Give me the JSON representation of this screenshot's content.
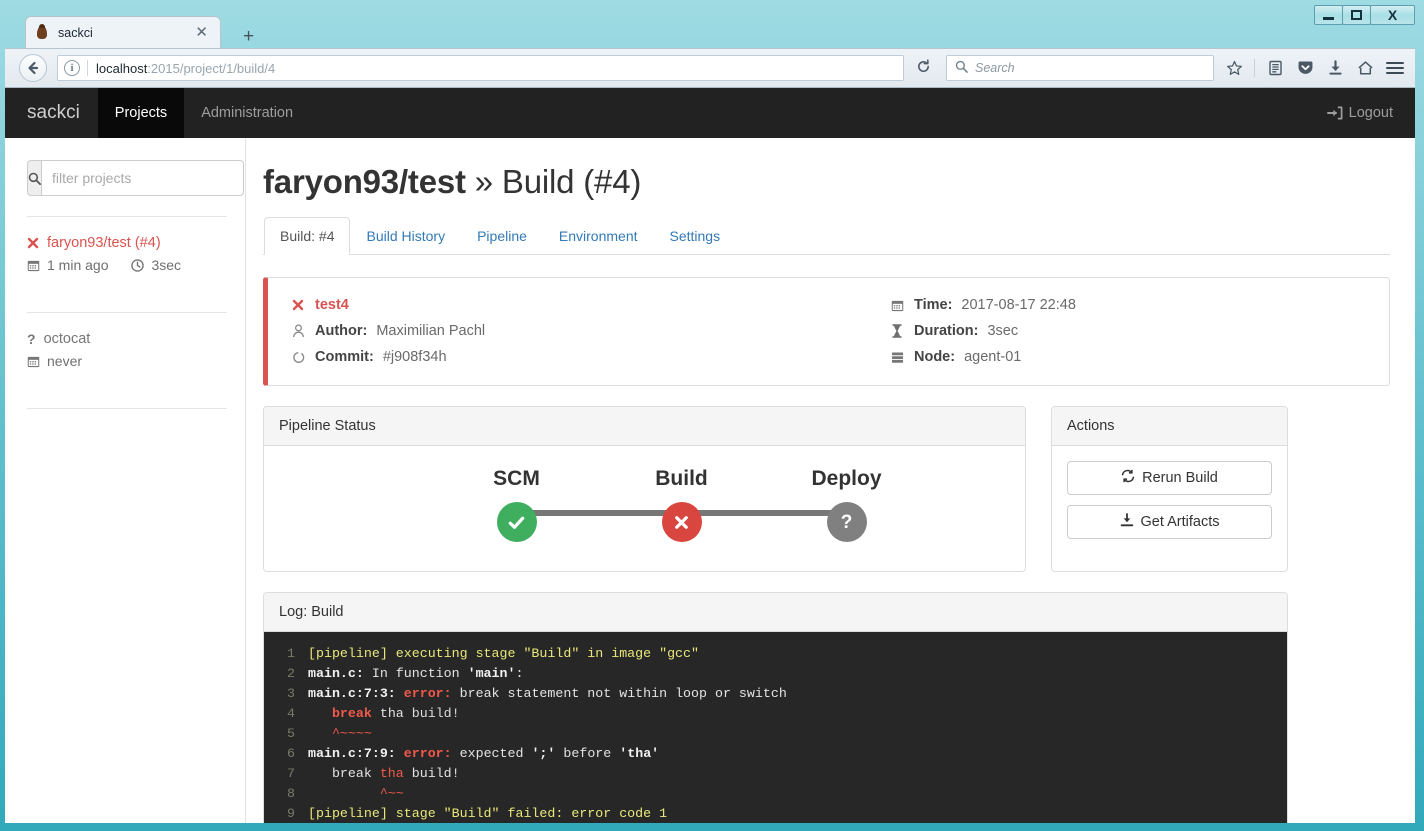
{
  "window": {
    "minimize_label": "Minimize",
    "maximize_label": "Maximize",
    "close_label": "Close"
  },
  "browser": {
    "tab_title": "sackci",
    "tab_close_glyph": "✕",
    "newtab_glyph": "+",
    "back_glyph": "←",
    "reload_glyph": "⟳",
    "url_host": "localhost",
    "url_rest": ":2015/project/1/build/4",
    "search_placeholder": "Search",
    "search_glyph": "⚲",
    "identity_glyph": "i",
    "icons": {
      "bookmark": "☆",
      "library": "Ὅ1",
      "pocket": "▽",
      "downloads": "⬇",
      "home": "⌂",
      "menu": "☰"
    }
  },
  "appnav": {
    "brand": "sackci",
    "items": [
      {
        "label": "Projects",
        "active": true
      },
      {
        "label": "Administration",
        "active": false
      }
    ],
    "logout_label": "Logout"
  },
  "sidebar": {
    "filter_placeholder": "filter projects",
    "search_glyph": "⚲",
    "projects": [
      {
        "status_icon": "failed",
        "status_glyph": "✖",
        "name": "faryon93/test (#4)",
        "time_glyph": "Ὄ5",
        "time": "1 min ago",
        "duration_glyph": "ὕ2",
        "duration": "3sec",
        "color": "#d9534f"
      },
      {
        "status_icon": "unknown",
        "status_glyph": "?",
        "name": "octocat",
        "time_glyph": "Ὄ5",
        "time": "never",
        "duration_glyph": "",
        "duration": "",
        "color": "#777777"
      }
    ]
  },
  "page": {
    "title_project": "faryon93/test",
    "title_sep": "»",
    "title_build": "Build (#4)",
    "tabs": [
      {
        "label": "Build: #4",
        "active": true
      },
      {
        "label": "Build History",
        "active": false
      },
      {
        "label": "Pipeline",
        "active": false
      },
      {
        "label": "Environment",
        "active": false
      },
      {
        "label": "Settings",
        "active": false
      }
    ]
  },
  "build_info": {
    "accent_color": "#d9534f",
    "status_glyph": "✖",
    "build_name": "test4",
    "left": [
      {
        "icon": "user-icon",
        "glyph": "☺",
        "label": "Author:",
        "value": "Maximilian Pachl"
      },
      {
        "icon": "commit-icon",
        "glyph": "○",
        "label": "Commit:",
        "value": "#j908f34h"
      }
    ],
    "right": [
      {
        "icon": "calendar-icon",
        "glyph": "Ὄ5",
        "label": "Time:",
        "value": "2017-08-17 22:48"
      },
      {
        "icon": "hourglass-icon",
        "glyph": "⌛",
        "label": "Duration:",
        "value": "3sec"
      },
      {
        "icon": "server-icon",
        "glyph": "☰",
        "label": "Node:",
        "value": "agent-01"
      }
    ]
  },
  "pipeline_panel": {
    "heading": "Pipeline Status",
    "stages": [
      {
        "label": "SCM",
        "state": "ok",
        "glyph": "✔",
        "color": "#3fae5f"
      },
      {
        "label": "Build",
        "state": "fail",
        "glyph": "✖",
        "color": "#d9453f"
      },
      {
        "label": "Deploy",
        "state": "unknown",
        "glyph": "?",
        "color": "#808080"
      }
    ]
  },
  "actions_panel": {
    "heading": "Actions",
    "buttons": [
      {
        "label": "Rerun Build",
        "glyph": "⟳"
      },
      {
        "label": "Get Artifacts",
        "glyph": "⬇"
      }
    ]
  },
  "log_panel": {
    "heading": "Log: Build",
    "lines": [
      {
        "n": "1",
        "spans": [
          {
            "t": "[pipeline] executing stage \"Build\" in image \"gcc\"",
            "c": "c-yellow"
          }
        ]
      },
      {
        "n": "2",
        "spans": [
          {
            "t": "main.c:",
            "c": "c-white"
          },
          {
            "t": " In function ",
            "c": "c-plain"
          },
          {
            "t": "'main'",
            "c": "c-white"
          },
          {
            "t": ":",
            "c": "c-plain"
          }
        ]
      },
      {
        "n": "3",
        "spans": [
          {
            "t": "main.c:7:3: ",
            "c": "c-white"
          },
          {
            "t": "error:",
            "c": "c-red"
          },
          {
            "t": " break statement not within loop or switch",
            "c": "c-plain"
          }
        ]
      },
      {
        "n": "4",
        "spans": [
          {
            "t": "   ",
            "c": "c-plain"
          },
          {
            "t": "break",
            "c": "c-red"
          },
          {
            "t": " tha ",
            "c": "c-plain"
          },
          {
            "t": "build!",
            "c": "c-blue"
          }
        ]
      },
      {
        "n": "5",
        "spans": [
          {
            "t": "   ^~~~~",
            "c": "c-redn"
          }
        ]
      },
      {
        "n": "6",
        "spans": [
          {
            "t": "main.c:7:9: ",
            "c": "c-white"
          },
          {
            "t": "error:",
            "c": "c-red"
          },
          {
            "t": " expected ",
            "c": "c-plain"
          },
          {
            "t": "';'",
            "c": "c-white"
          },
          {
            "t": " before ",
            "c": "c-plain"
          },
          {
            "t": "'tha'",
            "c": "c-white"
          }
        ]
      },
      {
        "n": "7",
        "spans": [
          {
            "t": "   break ",
            "c": "c-plain"
          },
          {
            "t": "tha",
            "c": "c-redn"
          },
          {
            "t": " build!",
            "c": "c-plain"
          }
        ]
      },
      {
        "n": "8",
        "spans": [
          {
            "t": "         ^~~",
            "c": "c-redn"
          }
        ]
      },
      {
        "n": "9",
        "spans": [
          {
            "t": "[pipeline] stage \"Build\" failed: error code 1",
            "c": "c-yellow"
          }
        ]
      }
    ]
  }
}
